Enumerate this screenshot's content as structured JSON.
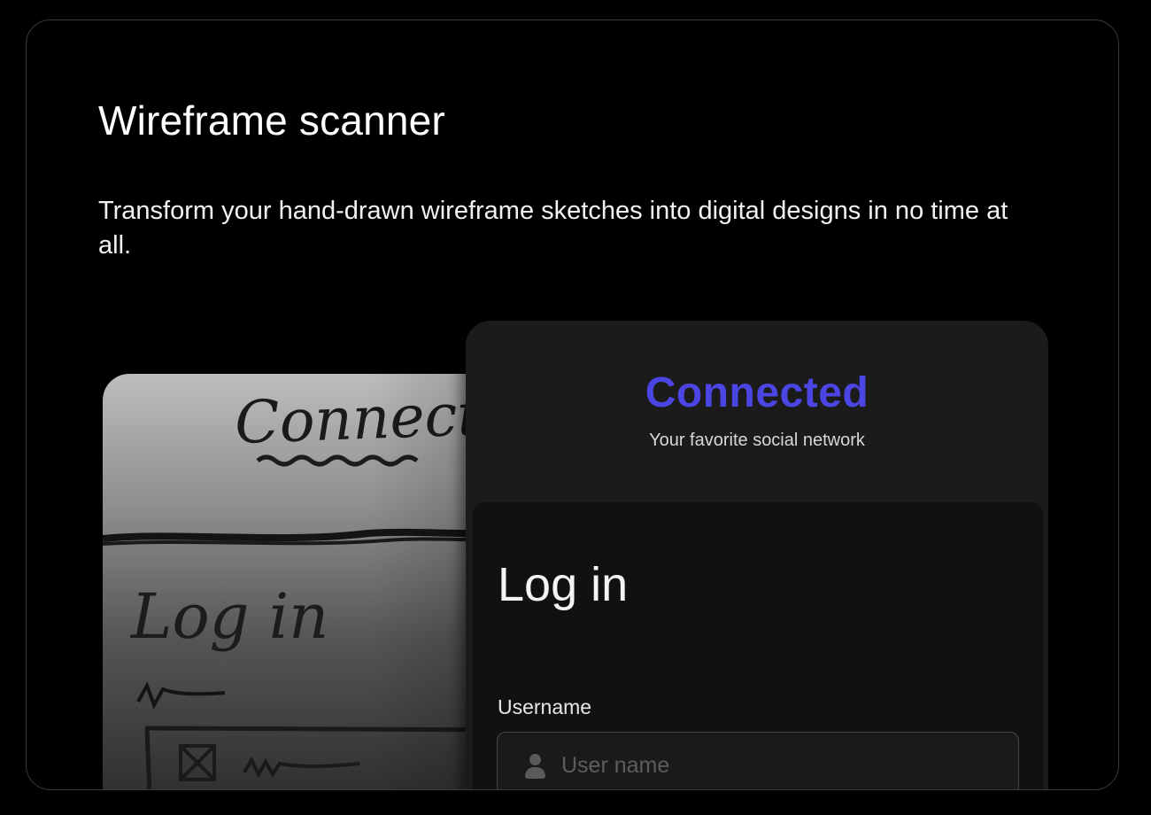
{
  "card": {
    "title": "Wireframe scanner",
    "description": "Transform your hand-drawn wireframe sketches into digital designs in no time at all."
  },
  "sketch": {
    "brand_text": "Connecte",
    "login_text": "Log in"
  },
  "digital": {
    "brand": "Connected",
    "brand_color": "#4b45e4",
    "tagline": "Your favorite social network",
    "login_heading": "Log in",
    "username_label": "Username",
    "username_placeholder": "User name",
    "username_icon": "user-icon"
  }
}
